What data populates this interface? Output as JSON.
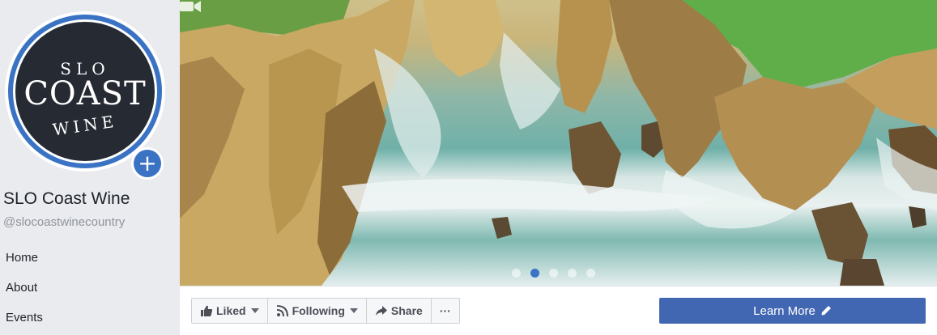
{
  "profile": {
    "logo": {
      "line1": "SLO",
      "line2": "COAST",
      "line3": "WINE"
    },
    "name": "SLO Coast Wine",
    "handle": "@slocoastwinecountry"
  },
  "nav": {
    "items": [
      {
        "label": "Home"
      },
      {
        "label": "About"
      },
      {
        "label": "Events"
      }
    ]
  },
  "cover": {
    "slide_count": 5,
    "active_slide": 2
  },
  "actions": {
    "liked_label": "Liked",
    "following_label": "Following",
    "share_label": "Share",
    "more_label": "···",
    "cta_label": "Learn More"
  },
  "colors": {
    "accent": "#4267b2",
    "ring": "#3b73c4",
    "logo_bg": "#262a33"
  },
  "icons": {
    "add_photo": "plus-icon",
    "like": "thumbs-up-icon",
    "follow": "rss-icon",
    "share": "share-arrow-icon",
    "edit": "pencil-icon",
    "cover_type": "video-camera-icon"
  }
}
